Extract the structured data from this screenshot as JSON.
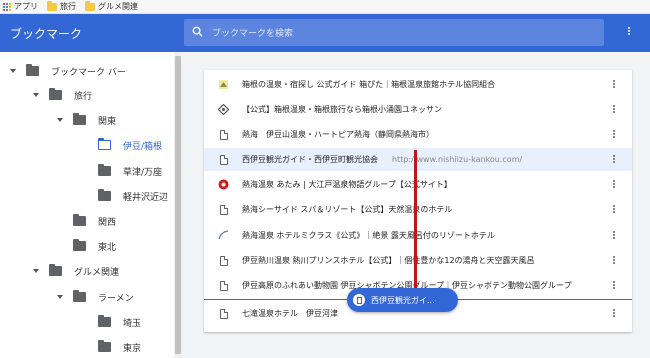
{
  "bookmarks_bar": {
    "items": [
      {
        "label": "アプリ",
        "icon": "apps-grid-icon"
      },
      {
        "label": "旅行",
        "icon": "folder-icon"
      },
      {
        "label": "グルメ関連",
        "icon": "folder-icon"
      }
    ]
  },
  "header": {
    "title": "ブックマーク",
    "search_placeholder": "ブックマークを検索"
  },
  "sidebar": {
    "items": [
      {
        "label": "ブックマーク バー",
        "expanded": true,
        "level": 0
      },
      {
        "label": "旅行",
        "expanded": true,
        "level": 1
      },
      {
        "label": "関東",
        "expanded": true,
        "level": 2
      },
      {
        "label": "伊豆/箱根",
        "selected": true,
        "level": 3
      },
      {
        "label": "草津/万座",
        "level": 3
      },
      {
        "label": "軽井沢近辺",
        "level": 3
      },
      {
        "label": "関西",
        "level": 2
      },
      {
        "label": "東北",
        "level": 2
      },
      {
        "label": "グルメ関連",
        "expanded": true,
        "level": 1
      },
      {
        "label": "ラーメン",
        "expanded": true,
        "level": 2
      },
      {
        "label": "埼玉",
        "level": 3
      },
      {
        "label": "東京",
        "level": 3
      }
    ]
  },
  "bookmarks": [
    {
      "title": "箱根の温泉・宿探し 公式ガイド 箱ぴた｜箱根温泉旅館ホテル協同組合",
      "url": "",
      "favicon": "hakone-favicon"
    },
    {
      "title": "【公式】箱根温泉・箱根旅行なら箱根小涌園ユネッサン",
      "url": "",
      "favicon": "diamond-favicon"
    },
    {
      "title": "熱海　伊豆山温泉・ハートピア熱海（静岡県熱海市）",
      "url": "",
      "favicon": "page-icon"
    },
    {
      "title": "西伊豆観光ガイド・西伊豆町観光協会",
      "url": "http://www.nishiizu-kankou.com/",
      "favicon": "page-icon",
      "highlighted": true
    },
    {
      "title": "熱海温泉 あたみ | 大江戸温泉物語グループ【公式サイト】",
      "url": "",
      "favicon": "red-circle-favicon"
    },
    {
      "title": "熱海シーサイド スパ＆リゾート【公式】天然温泉のホテル",
      "url": "",
      "favicon": "page-icon"
    },
    {
      "title": "熱海温泉 ホテルミクラス《公式》｜絶景 露天風呂付のリゾートホテル",
      "url": "",
      "favicon": "arc-favicon"
    },
    {
      "title": "伊豆熱川温泉 熱川プリンスホテル【公式】｜個性豊かな12の湯舟と天空露天風呂",
      "url": "",
      "favicon": "page-icon"
    },
    {
      "title": "伊豆高原のふれあい動物園 伊豆シャボテン公園グループ｜伊豆シャボテン動物公園グループ",
      "url": "",
      "favicon": "page-icon"
    },
    {
      "title": "七滝温泉ホテル　伊豆河津",
      "url": "",
      "favicon": "page-icon"
    }
  ],
  "drag_chip": {
    "label": "西伊豆観光ガイ..."
  },
  "colors": {
    "accent": "#3367d6",
    "arrow": "#c0151d",
    "highlight": "#e8f0fe"
  }
}
